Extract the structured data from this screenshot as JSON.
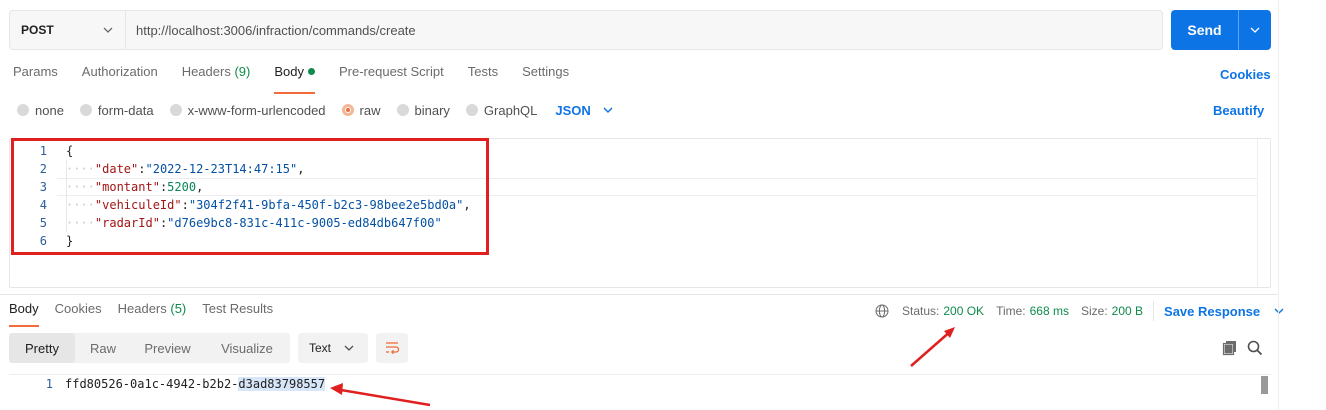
{
  "request": {
    "method": "POST",
    "url": "http://localhost:3006/infraction/commands/create",
    "send_label": "Send"
  },
  "request_tabs": [
    {
      "label": "Params"
    },
    {
      "label": "Authorization"
    },
    {
      "label": "Headers",
      "count": "(9)"
    },
    {
      "label": "Body",
      "active": true
    },
    {
      "label": "Pre-request Script"
    },
    {
      "label": "Tests"
    },
    {
      "label": "Settings"
    }
  ],
  "cookies_link": "Cookies",
  "body_types": [
    "none",
    "form-data",
    "x-www-form-urlencoded",
    "raw",
    "binary",
    "GraphQL"
  ],
  "body_type_selected": "raw",
  "format": "JSON",
  "beautify_link": "Beautify",
  "editor": {
    "line_numbers": [
      "1",
      "2",
      "3",
      "4",
      "5",
      "6"
    ],
    "open_brace": "{",
    "close_brace": "}",
    "fields": [
      {
        "key": "\"date\"",
        "value": "\"2022-12-23T14:47:15\"",
        "comma": ","
      },
      {
        "key": "\"montant\"",
        "value": "5200",
        "comma": ","
      },
      {
        "key": "\"vehiculeId\"",
        "value": "\"304f2f41-9bfa-450f-b2c3-98bee2e5bd0a\"",
        "comma": ","
      },
      {
        "key": "\"radarId\"",
        "value": "\"d76e9bc8-831c-411c-9005-ed84db647f00\"",
        "comma": ""
      }
    ]
  },
  "response_tabs": [
    {
      "label": "Body",
      "active": true
    },
    {
      "label": "Cookies"
    },
    {
      "label": "Headers",
      "count": "(5)"
    },
    {
      "label": "Test Results"
    }
  ],
  "status": {
    "status_label": "Status:",
    "status_value": "200 OK",
    "time_label": "Time:",
    "time_value": "668 ms",
    "size_label": "Size:",
    "size_value": "200 B",
    "save_response": "Save Response"
  },
  "view_modes": [
    "Pretty",
    "Raw",
    "Preview",
    "Visualize"
  ],
  "view_selected": "Pretty",
  "text_format": "Text",
  "response_body": {
    "line_number": "1",
    "text_start": "ffd80526-0a1c-4942-b2b2-",
    "text_highlight": "d3ad83798557"
  },
  "colors": {
    "accent": "#f26b3a",
    "primary": "#0d74e6",
    "success": "#0f8a4b",
    "annotation": "#e01f1f"
  },
  "icons": [
    "chevron-down-icon",
    "globe-icon",
    "wrap-lines-icon",
    "copy-icon",
    "search-icon"
  ]
}
